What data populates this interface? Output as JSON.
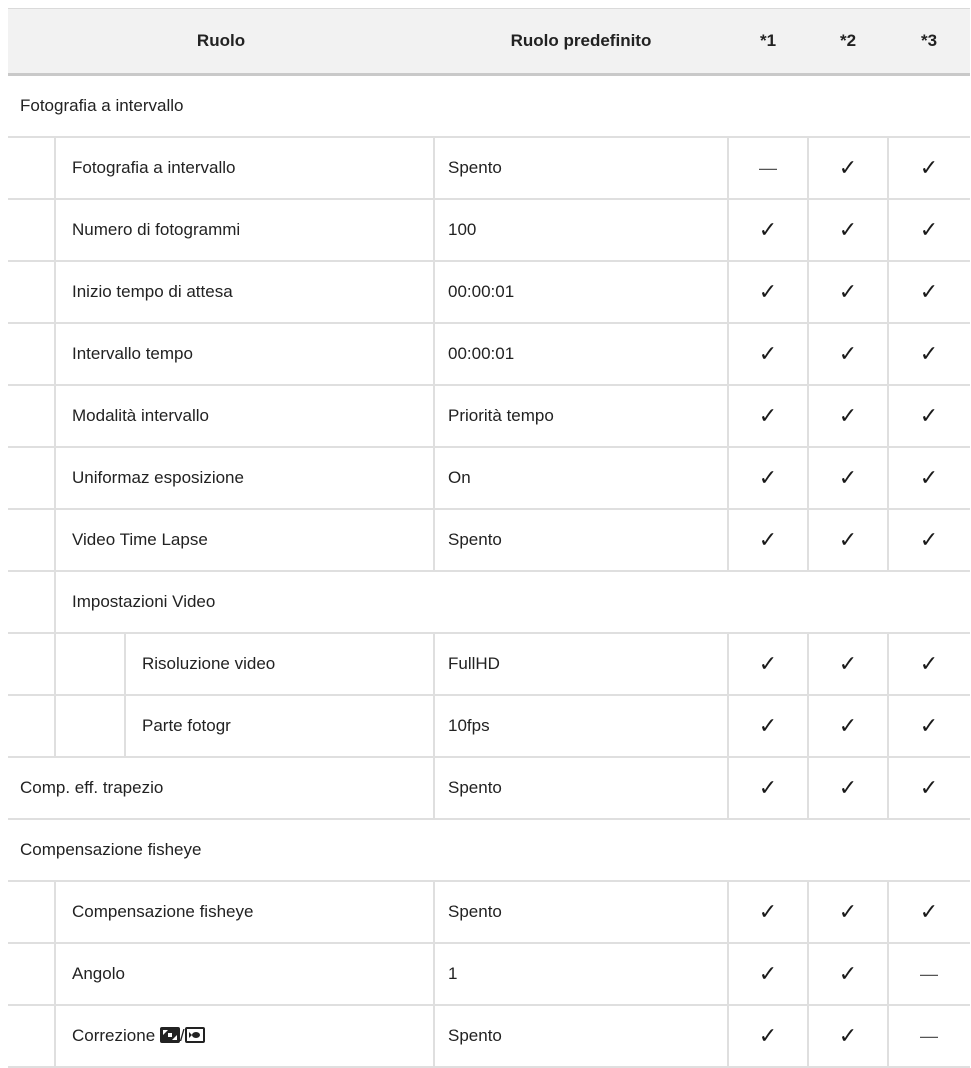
{
  "header": {
    "col_role": "Ruolo",
    "col_default": "Ruolo predefinito",
    "col1": "*1",
    "col2": "*2",
    "col3": "*3"
  },
  "check": "✓",
  "dash": "—",
  "sections": {
    "interval": {
      "title": "Fotografia a intervallo",
      "rows": [
        {
          "label": "Fotografia a intervallo",
          "default": "Spento",
          "c1": "—",
          "c2": "✓",
          "c3": "✓"
        },
        {
          "label": "Numero di fotogrammi",
          "default": "100",
          "c1": "✓",
          "c2": "✓",
          "c3": "✓"
        },
        {
          "label": "Inizio tempo di attesa",
          "default": "00:00:01",
          "c1": "✓",
          "c2": "✓",
          "c3": "✓"
        },
        {
          "label": "Intervallo tempo",
          "default": "00:00:01",
          "c1": "✓",
          "c2": "✓",
          "c3": "✓"
        },
        {
          "label": "Modalità intervallo",
          "default": "Priorità tempo",
          "c1": "✓",
          "c2": "✓",
          "c3": "✓"
        },
        {
          "label": "Uniformaz esposizione",
          "default": "On",
          "c1": "✓",
          "c2": "✓",
          "c3": "✓"
        },
        {
          "label": "Video Time Lapse",
          "default": "Spento",
          "c1": "✓",
          "c2": "✓",
          "c3": "✓"
        }
      ],
      "video_group": {
        "title": "Impostazioni Video",
        "rows": [
          {
            "label": "Risoluzione video",
            "default": "FullHD",
            "c1": "✓",
            "c2": "✓",
            "c3": "✓"
          },
          {
            "label": "Parte fotogr",
            "default": "10fps",
            "c1": "✓",
            "c2": "✓",
            "c3": "✓"
          }
        ]
      }
    },
    "keystone": {
      "label": "Comp. eff. trapezio",
      "default": "Spento",
      "c1": "✓",
      "c2": "✓",
      "c3": "✓"
    },
    "fisheye": {
      "title": "Compensazione fisheye",
      "rows": [
        {
          "label": "Compensazione fisheye",
          "default": "Spento",
          "c1": "✓",
          "c2": "✓",
          "c3": "✓"
        },
        {
          "label": "Angolo",
          "default": "1",
          "c1": "✓",
          "c2": "✓",
          "c3": "—"
        },
        {
          "label": "Correzione",
          "label_icons": [
            "aspect-icon",
            "fisheye-icon"
          ],
          "separator": "/",
          "default": "Spento",
          "c1": "✓",
          "c2": "✓",
          "c3": "—"
        }
      ]
    }
  }
}
